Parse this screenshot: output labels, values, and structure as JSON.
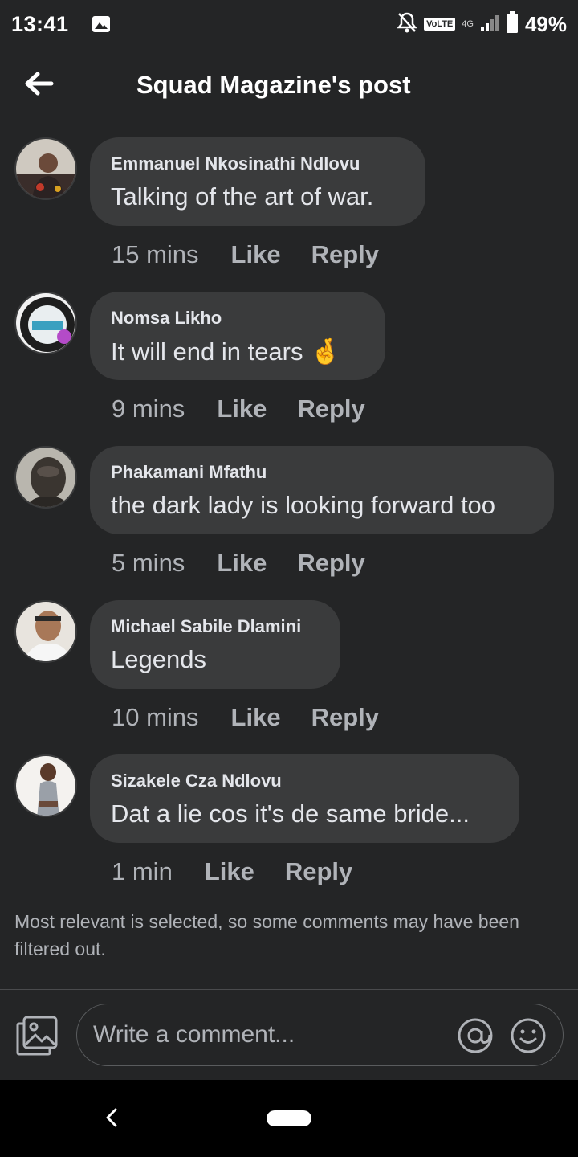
{
  "status": {
    "time": "13:41",
    "volte": "VoLTE",
    "network": "4G",
    "battery": "49%"
  },
  "header": {
    "title": "Squad Magazine's post"
  },
  "comments": [
    {
      "author": "Emmanuel Nkosinathi Ndlovu",
      "text": "Talking of the art of war.",
      "time": "15 mins",
      "like": "Like",
      "reply": "Reply"
    },
    {
      "author": "Nomsa Likho",
      "text": "It will end in tears 🤞",
      "time": "9 mins",
      "like": "Like",
      "reply": "Reply"
    },
    {
      "author": "Phakamani Mfathu",
      "text": "the dark lady is looking forward too",
      "time": "5 mins",
      "like": "Like",
      "reply": "Reply"
    },
    {
      "author": "Michael Sabile Dlamini",
      "text": "Legends",
      "time": "10 mins",
      "like": "Like",
      "reply": "Reply"
    },
    {
      "author": "Sizakele Cza Ndlovu",
      "text": "Dat a lie cos it's de same bride...",
      "time": "1 min",
      "like": "Like",
      "reply": "Reply"
    }
  ],
  "filter_note": "Most relevant is selected, so some comments may have been filtered out.",
  "composer": {
    "placeholder": "Write a comment..."
  }
}
